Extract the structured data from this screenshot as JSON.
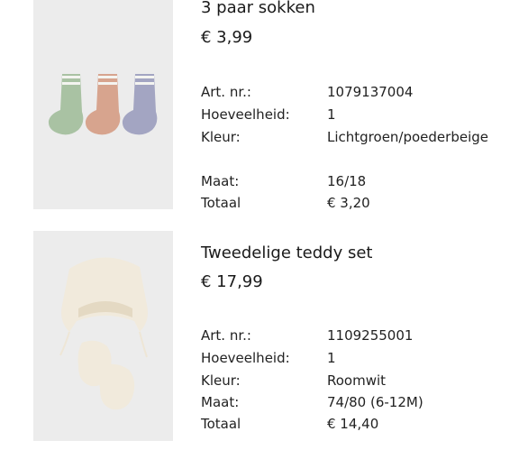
{
  "products": [
    {
      "name": "3 paar sokken",
      "price": "€ 3,99",
      "image_icon": "socks-image",
      "details": [
        {
          "label": "Art. nr.:",
          "value": "1079137004"
        },
        {
          "label": "Hoeveelheid:",
          "value": "1"
        },
        {
          "label": "Kleur:",
          "value": "Lichtgroen/poederbeige"
        },
        {
          "label": "Maat:",
          "value": "16/18"
        },
        {
          "label": "Totaal",
          "value": "€ 3,20"
        }
      ]
    },
    {
      "name": "Tweedelige teddy set",
      "price": "€ 17,99",
      "image_icon": "teddy-hat-mittens-image",
      "details": [
        {
          "label": "Art. nr.:",
          "value": "1109255001"
        },
        {
          "label": "Hoeveelheid:",
          "value": "1"
        },
        {
          "label": "Kleur:",
          "value": "Roomwit"
        },
        {
          "label": "Maat:",
          "value": "74/80 (6-12M)"
        },
        {
          "label": "Totaal",
          "value": "€ 14,40"
        }
      ]
    }
  ],
  "colors": {
    "image_background": "#ececec",
    "sock_green": "#a9c2a3",
    "sock_peach": "#d7a48e",
    "sock_lavender": "#a3a5c2",
    "teddy_cream": "#f1eadc"
  }
}
